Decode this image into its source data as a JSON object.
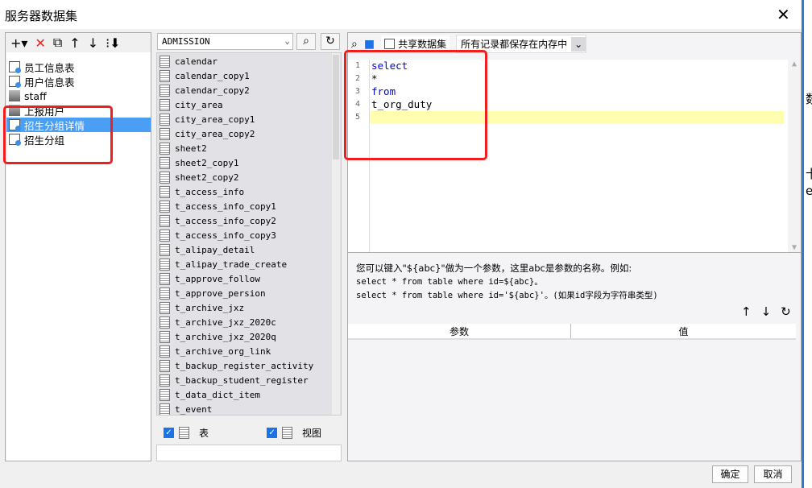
{
  "dialog": {
    "title": "服务器数据集",
    "ok": "确定",
    "cancel": "取消"
  },
  "background_app": {
    "texts": [
      "数",
      "卡",
      "e"
    ]
  },
  "left": {
    "toolbar": [
      "add",
      "delete",
      "copy",
      "up",
      "down",
      "sort"
    ],
    "items": [
      {
        "label": "员工信息表",
        "icon": "dataset"
      },
      {
        "label": "用户信息表",
        "icon": "dataset"
      },
      {
        "label": "staff",
        "icon": "server"
      },
      {
        "label": "上报用户",
        "icon": "server"
      },
      {
        "label": "招生分组详情",
        "icon": "dataset",
        "selected": true
      },
      {
        "label": "招生分组",
        "icon": "dataset"
      }
    ]
  },
  "middle": {
    "database": "ADMISSION",
    "tables": [
      "calendar",
      "calendar_copy1",
      "calendar_copy2",
      "city_area",
      "city_area_copy1",
      "city_area_copy2",
      "sheet2",
      "sheet2_copy1",
      "sheet2_copy2",
      "t_access_info",
      "t_access_info_copy1",
      "t_access_info_copy2",
      "t_access_info_copy3",
      "t_alipay_detail",
      "t_alipay_trade_create",
      "t_approve_follow",
      "t_approve_persion",
      "t_archive_jxz",
      "t_archive_jxz_2020c",
      "t_archive_jxz_2020q",
      "t_archive_org_link",
      "t_backup_register_activity",
      "t_backup_student_register",
      "t_data_dict_item",
      "t_event"
    ],
    "table_check": "表",
    "view_check": "视图"
  },
  "right": {
    "share_label": "共享数据集",
    "mode": "所有记录都保存在内存中",
    "code": [
      {
        "n": "1",
        "text": "select",
        "kw": true
      },
      {
        "n": "2",
        "text": "*",
        "kw": false
      },
      {
        "n": "3",
        "text": "from",
        "kw": true
      },
      {
        "n": "4",
        "text": "t_org_duty",
        "kw": false
      },
      {
        "n": "5",
        "text": "",
        "kw": false
      }
    ],
    "hint": [
      "您可以键入\"${abc}\"做为一个参数，这里abc是参数的名称。例如:",
      "select * from table where id=${abc}。",
      "select * from table where id='${abc}'。(如果id字段为字符串类型)"
    ],
    "param_header": "参数",
    "value_header": "值"
  },
  "colors": {
    "selection": "#4a9ff5",
    "highlight_box": "#f21d1d",
    "keyword": "#0000ee",
    "current_line": "#fffeb0"
  }
}
